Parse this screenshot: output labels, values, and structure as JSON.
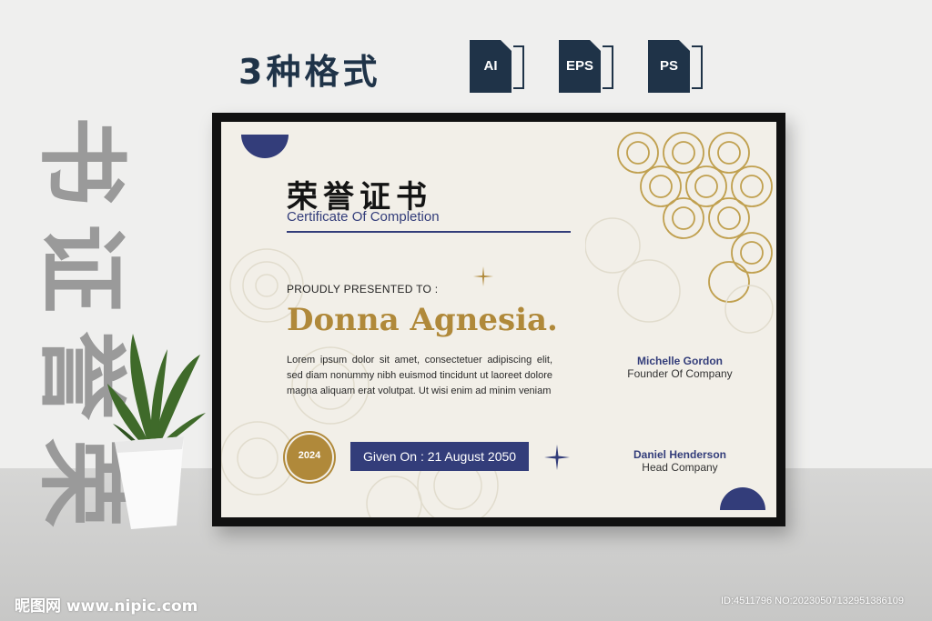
{
  "header": {
    "formats_title": "3种格式",
    "formats": [
      {
        "label": "AI",
        "icon": "ai-file-icon"
      },
      {
        "label": "EPS",
        "icon": "eps-file-icon"
      },
      {
        "label": "PS",
        "icon": "ps-file-icon"
      }
    ]
  },
  "side_title": [
    "书",
    "证",
    "誉",
    "荣"
  ],
  "certificate": {
    "title": "荣誉证书",
    "subtitle": "Certificate Of Completion",
    "presented_label": "PROUDLY PRESENTED TO :",
    "recipient": "Donna Agnesia.",
    "body": "Lorem ipsum dolor sit amet, consectetuer adipiscing elit, sed diam nonummy nibh euismod tincidunt ut laoreet dolore magna aliquam erat volutpat. Ut wisi enim ad minim veniam",
    "seal_year": "2024",
    "given_on": "Given On : 21 August 2050",
    "signatures": [
      {
        "name": "Michelle Gordon",
        "role": "Founder Of Company"
      },
      {
        "name": "Daniel Henderson",
        "role": "Head Company"
      }
    ],
    "colors": {
      "navy": "#333d7a",
      "gold": "#b0893a",
      "paper": "#f2efe8"
    }
  },
  "watermark": {
    "left": "昵图网 www.nipic.com",
    "right": "ID:4511796 NO:20230507132951386109"
  }
}
